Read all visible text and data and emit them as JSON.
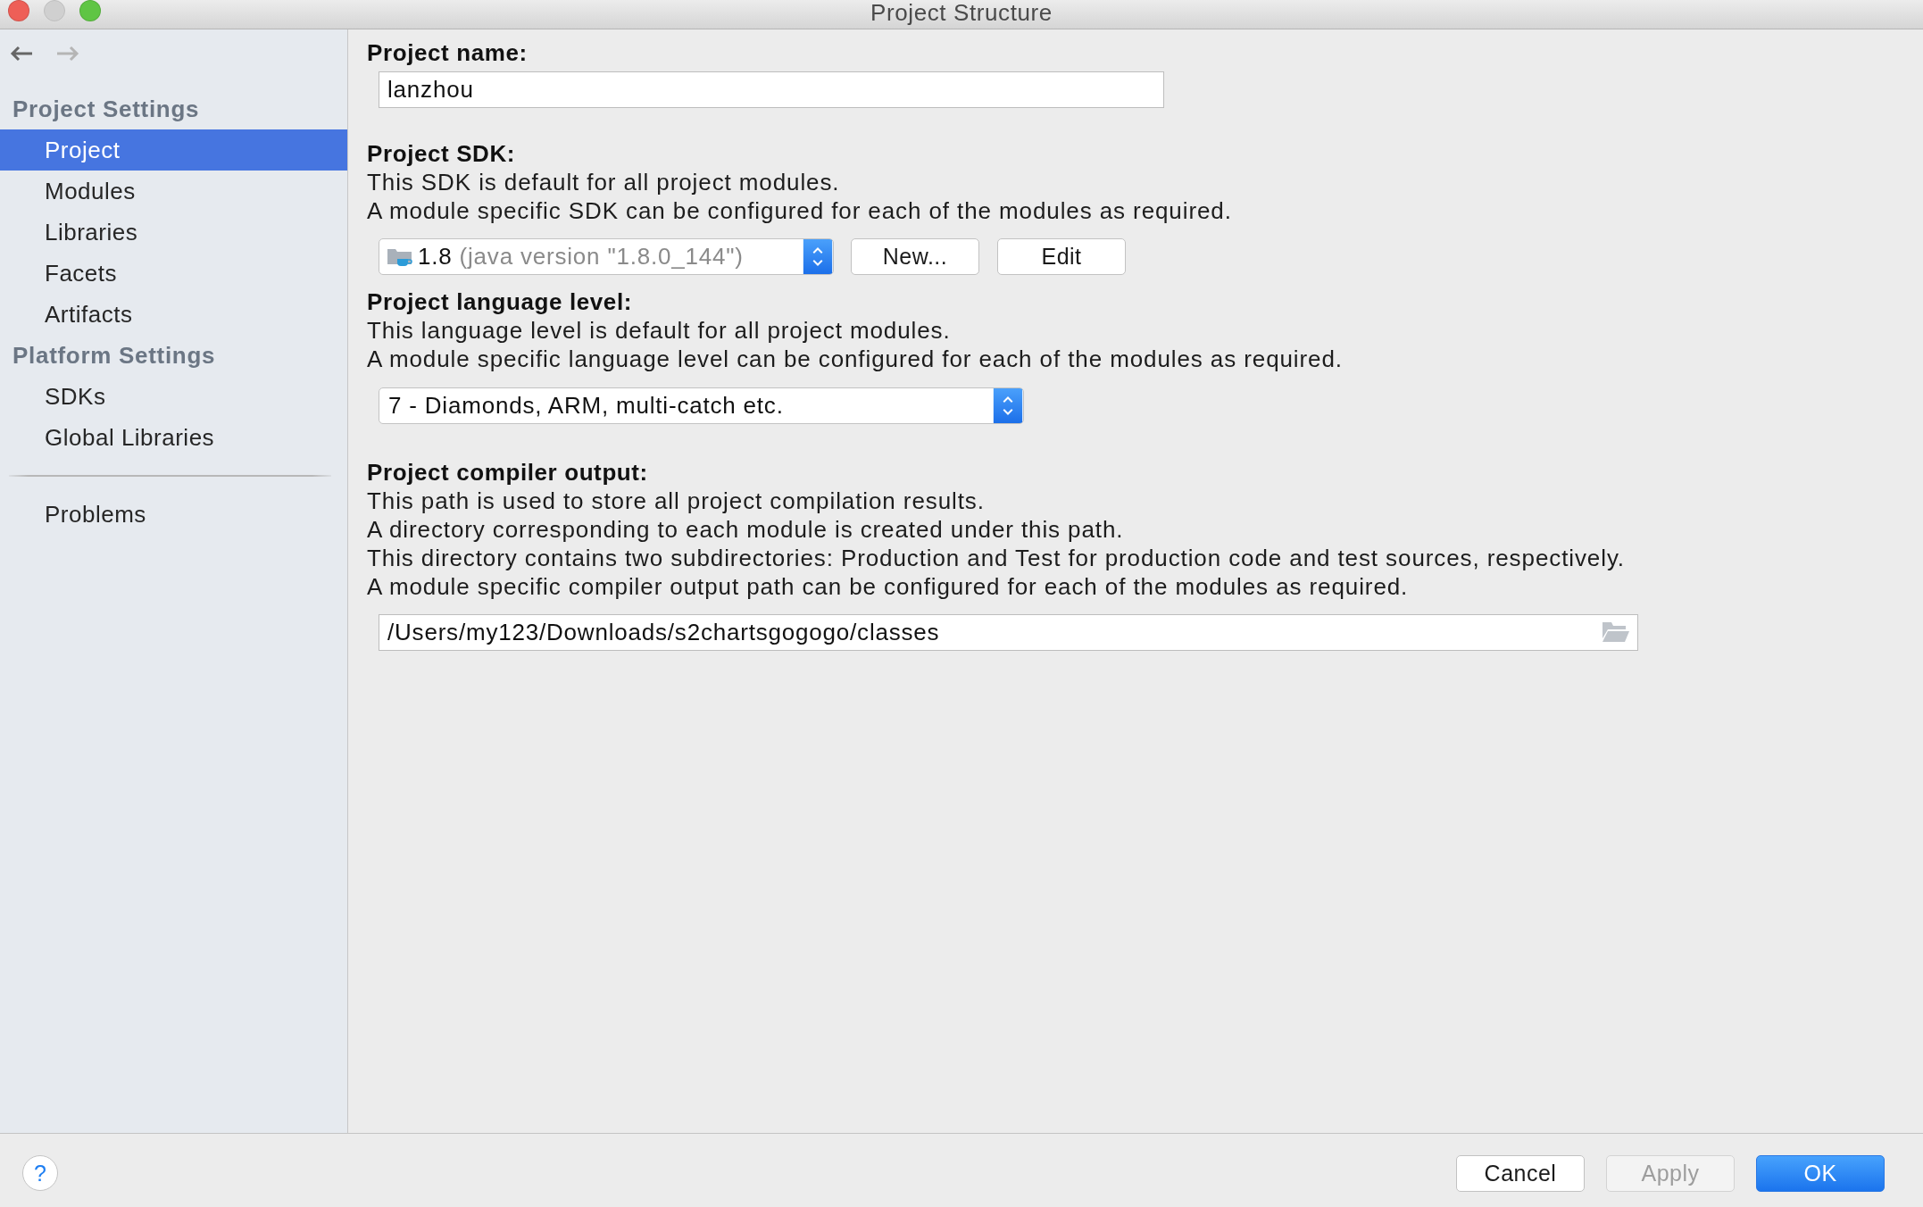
{
  "window": {
    "title": "Project Structure",
    "controls": [
      {
        "kind": "close",
        "disabled": false
      },
      {
        "kind": "minimize",
        "disabled": true
      },
      {
        "kind": "zoom",
        "disabled": false
      }
    ]
  },
  "navigation": [
    {
      "kind": "back",
      "disabled": false
    },
    {
      "kind": "forward",
      "disabled": true
    }
  ],
  "sidebar": {
    "sections": [
      {
        "title": "Project Settings",
        "items": [
          {
            "label": "Project",
            "selected": true
          },
          {
            "label": "Modules",
            "selected": false
          },
          {
            "label": "Libraries",
            "selected": false
          },
          {
            "label": "Facets",
            "selected": false
          },
          {
            "label": "Artifacts",
            "selected": false
          }
        ]
      },
      {
        "title": "Platform Settings",
        "items": [
          {
            "label": "SDKs",
            "selected": false
          },
          {
            "label": "Global Libraries",
            "selected": false
          }
        ]
      }
    ],
    "footer_items": [
      {
        "label": "Problems",
        "selected": false
      }
    ]
  },
  "project_name": {
    "label": "Project name:",
    "value": "lanzhou"
  },
  "project_sdk": {
    "label": "Project SDK:",
    "description": [
      "This SDK is default for all project modules.",
      "A module specific SDK can be configured for each of the modules as required."
    ],
    "sdk": {
      "name": "1.8",
      "detail": "(java version \"1.8.0_144\")"
    },
    "buttons": [
      {
        "label": "New..."
      },
      {
        "label": "Edit"
      }
    ]
  },
  "language_level": {
    "label": "Project language level:",
    "description": [
      "This language level is default for all project modules.",
      "A module specific language level can be configured for each of the modules as required."
    ],
    "value": "7 - Diamonds, ARM, multi-catch etc."
  },
  "compiler_output": {
    "label": "Project compiler output:",
    "description": [
      "This path is used to store all project compilation results.",
      "A directory corresponding to each module is created under this path.",
      "This directory contains two subdirectories: Production and Test for production code and test sources, respectively.",
      "A module specific compiler output path can be configured for each of the modules as required."
    ],
    "value": "/Users/my123/Downloads/s2chartsgogogo/classes"
  },
  "footer": {
    "help_button": {
      "label": "?"
    },
    "buttons": [
      {
        "label": "Cancel",
        "kind": "normal",
        "disabled": false
      },
      {
        "label": "Apply",
        "kind": "normal",
        "disabled": true
      },
      {
        "label": "OK",
        "kind": "primary",
        "disabled": false
      }
    ]
  }
}
